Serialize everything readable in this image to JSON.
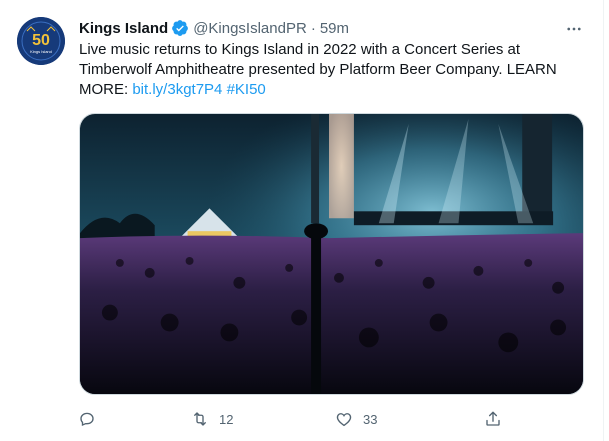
{
  "tweet": {
    "author_name": "Kings Island",
    "author_handle": "@KingsIslandPR",
    "separator": "·",
    "time": "59m",
    "text_main": "Live music returns to Kings Island in 2022 with a Concert Series at Timberwolf Amphitheatre presented by Platform Beer Company. LEARN MORE: ",
    "link_text": "bit.ly/3kgt7P4",
    "hashtag": "#KI50",
    "media_alt": "Concert crowd at Timberwolf Amphitheatre",
    "verified_icon": "verified-badge-icon",
    "more_icon": "more-horizontal-icon"
  },
  "actions": {
    "reply_count": "",
    "retweet_count": "12",
    "like_count": "33",
    "share_count": ""
  },
  "avatar": {
    "badge_text": "50",
    "logo_text": "Kings Island"
  },
  "colors": {
    "link": "#1d9bf0",
    "secondary": "#536471",
    "verified": "#1d9bf0",
    "text": "#0f1419"
  }
}
